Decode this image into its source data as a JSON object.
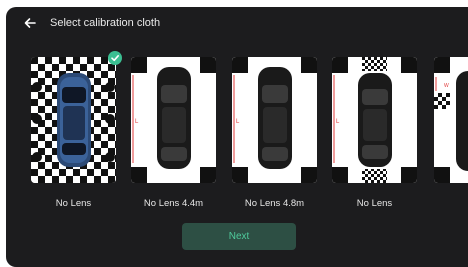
{
  "header": {
    "title": "Select calibration cloth",
    "back_icon": "arrow-left-icon"
  },
  "cards": [
    {
      "label": "No Lens",
      "selected": true,
      "pattern": "full-checkerboard"
    },
    {
      "label": "No Lens 4.4m",
      "selected": false,
      "pattern": "corner-squares"
    },
    {
      "label": "No Lens 4.8m",
      "selected": false,
      "pattern": "corner-squares"
    },
    {
      "label": "No Lens",
      "selected": false,
      "pattern": "corner-squares-with-checker-blocks"
    },
    {
      "label": "",
      "selected": false,
      "pattern": "partial"
    }
  ],
  "next_button": {
    "label": "Next",
    "enabled": false
  },
  "colors": {
    "background": "#1c1c1e",
    "accent": "#3bbf92",
    "button_disabled_bg": "#2d4f44",
    "button_disabled_text": "#4fcb9c",
    "guide_line": "#e23b3b"
  }
}
